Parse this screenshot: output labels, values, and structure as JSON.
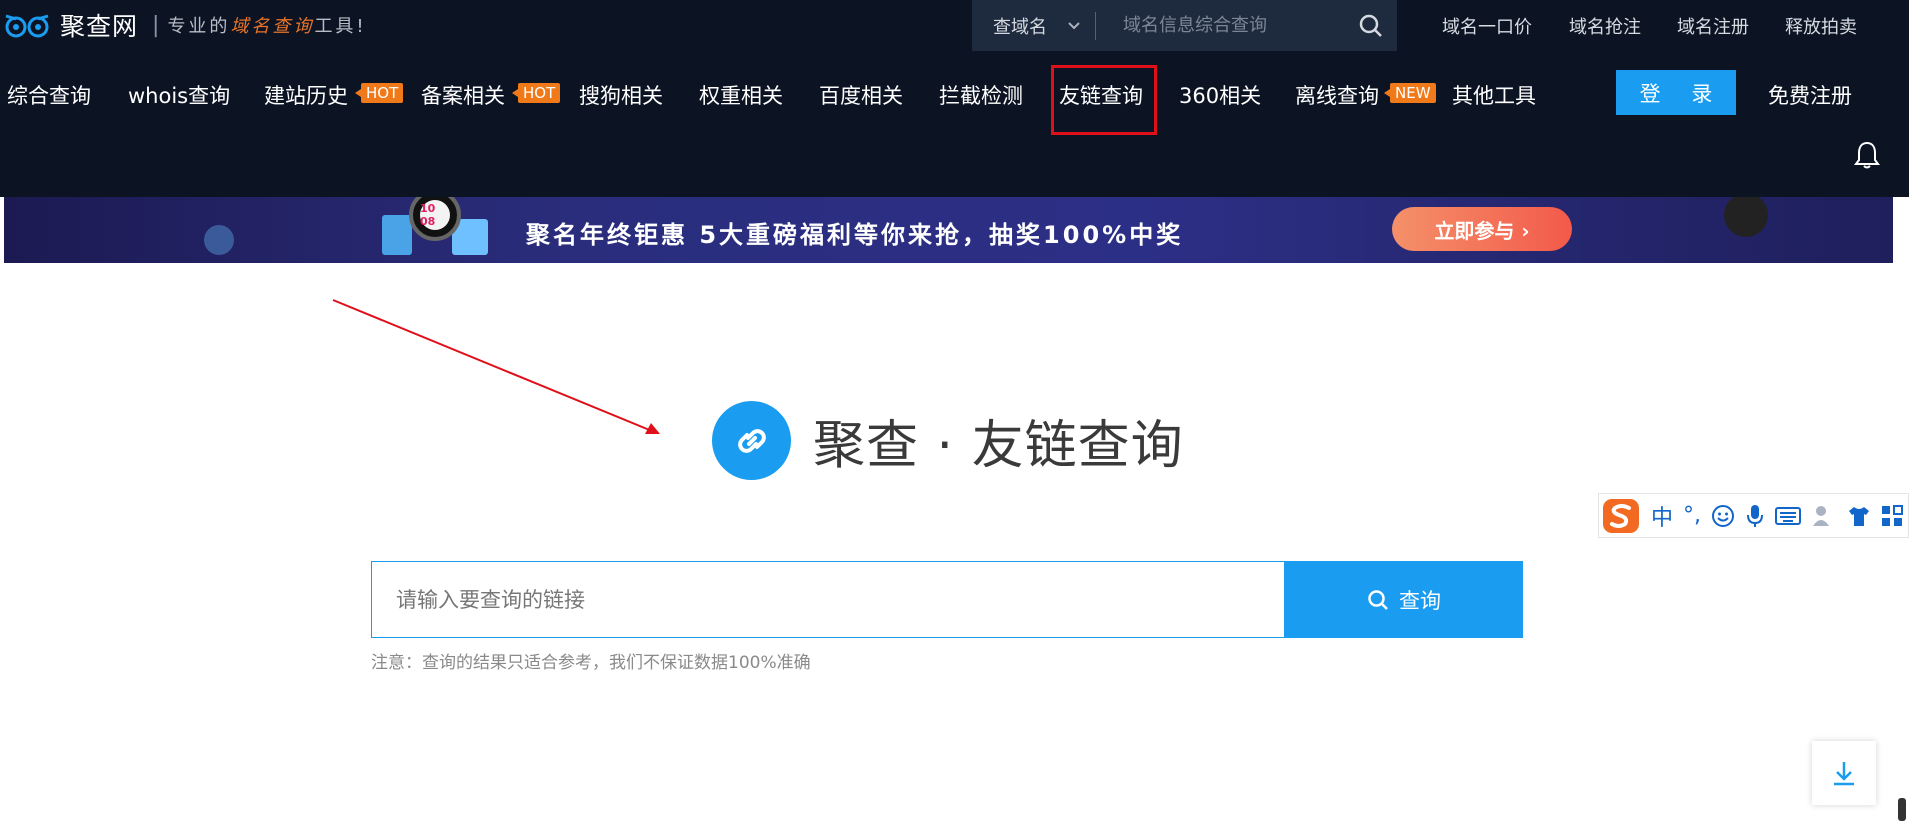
{
  "brand": {
    "name": "聚查网",
    "slogan_prefix": "专业的",
    "slogan_highlight": "域名查询",
    "slogan_suffix": "工具!"
  },
  "search": {
    "type_label": "查域名",
    "placeholder": "域名信息综合查询"
  },
  "top_links": [
    "域名一口价",
    "域名抢注",
    "域名注册",
    "释放拍卖"
  ],
  "nav": {
    "items": [
      "综合查询",
      "whois查询",
      "建站历史",
      "备案相关",
      "搜狗相关",
      "权重相关",
      "百度相关",
      "拦截检测",
      "友链查询",
      "360相关",
      "离线查询",
      "其他工具"
    ],
    "badges": {
      "hot": "HOT",
      "new": "NEW"
    },
    "login_label": "登 录",
    "register_label": "免费注册"
  },
  "banner": {
    "text": "聚名年终钜惠 5大重磅福利等你来抢，抽奖100%中奖",
    "cta": "立即参与 ›",
    "watch_number": "10 08"
  },
  "hero": {
    "title": "聚查 · 友链查询"
  },
  "query": {
    "placeholder": "请输入要查询的链接",
    "button_label": "查询",
    "note": "注意：查询的结果只适合参考，我们不保证数据100%准确"
  },
  "ime": {
    "items": [
      "中",
      "°,"
    ]
  },
  "colors": {
    "nav_bg": "#0c1424",
    "accent": "#1a9cf0",
    "badge": "#f07a1a",
    "highlight": "#e0101a"
  }
}
